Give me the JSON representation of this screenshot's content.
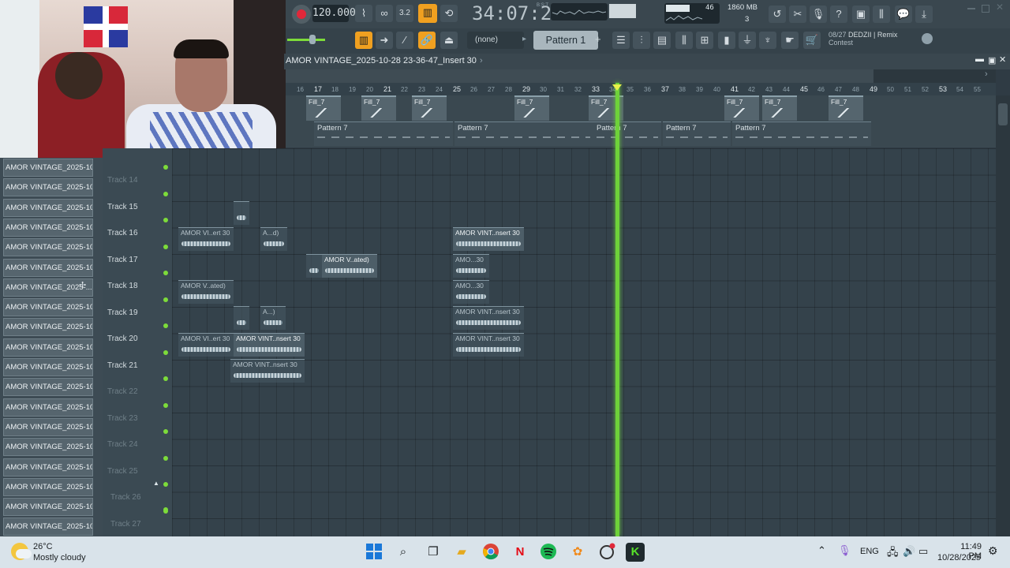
{
  "toolbar": {
    "tempo": "120.000",
    "time": "34:07:2",
    "time_sub": "B:S:T",
    "cpu": "46",
    "mem": "1860 MB",
    "voices": "3",
    "pattern_none": "(none)",
    "pattern_name": "Pattern 1",
    "hint_date": "08/27",
    "hint_line1": "DEDZII | Remix",
    "hint_line2": "Contest"
  },
  "playlist": {
    "title": "AMOR VINTAGE_2025-10-28 23-36-47_Insert 30",
    "ruler": [
      "16",
      "17",
      "18",
      "19",
      "20",
      "21",
      "22",
      "23",
      "24",
      "25",
      "26",
      "27",
      "28",
      "29",
      "30",
      "31",
      "32",
      "33",
      "34",
      "35",
      "36",
      "37",
      "38",
      "39",
      "40",
      "41",
      "42",
      "43",
      "44",
      "45",
      "46",
      "47",
      "48",
      "49",
      "50",
      "51",
      "52",
      "53",
      "54",
      "55"
    ],
    "fills": [
      "Fill_7",
      "Fill_7",
      "Fill_7",
      "Fill_7",
      "Fill_7",
      "Fill_7",
      "Fill_7",
      "Fill_7"
    ],
    "patterns": [
      "Pattern 7",
      "Pattern 7",
      "Pattern 7",
      "Pattern 7",
      "Pattern 7"
    ],
    "tracks": [
      "Track 14",
      "Track 15",
      "Track 16",
      "Track 17",
      "Track 18",
      "Track 19",
      "Track 20",
      "Track 21",
      "Track 22",
      "Track 23",
      "Track 24",
      "Track 25",
      "Track 26",
      "Track 27"
    ],
    "clips": {
      "c16a": "AMOR VI..ert 30",
      "c16b": "A...d)",
      "c16c": "AMOR VINT..nsert 30",
      "c17a": "AMOR V..ated)",
      "c17b": "AMO...30",
      "c18a": "AMOR V..ated)",
      "c18b": "AMO...30",
      "c19a": "A...)",
      "c19b": "AMOR VINT..nsert 30",
      "c20a": "AMOR VI..ert 30",
      "c20b": "AMOR VINT..nsert 30",
      "c20c": "AMOR VINT..nsert 30",
      "c21a": "AMOR VINT..nsert 30"
    }
  },
  "browser": {
    "items": [
      "AMOR VINTAGE_2025-10-...",
      "AMOR VINTAGE_2025-10-...",
      "AMOR VINTAGE_2025-10-...",
      "AMOR VINTAGE_2025-10-...",
      "AMOR VINTAGE_2025-10-...",
      "AMOR VINTAGE_2025-10-...",
      "AMOR VINTAGE_2025-...",
      "AMOR VINTAGE_2025-10-...",
      "AMOR VINTAGE_2025-10-...",
      "AMOR VINTAGE_2025-10-...",
      "AMOR VINTAGE_2025-10-...",
      "AMOR VINTAGE_2025-10-...",
      "AMOR VINTAGE_2025-10-...",
      "AMOR VINTAGE_2025-10-...",
      "AMOR VINTAGE_2025-10-...",
      "AMOR VINTAGE_2025-10-...",
      "AMOR VINTAGE_2025-10-...",
      "AMOR VINTAGE_2025-10-...",
      "AMOR VINTAGE_2025-10-..."
    ]
  },
  "taskbar": {
    "temperature": "26°C",
    "weather": "Mostly cloudy",
    "language": "ENG",
    "clock_time": "11:49 PM",
    "clock_date": "10/28/2025"
  },
  "colors": {
    "playhead": "#6ed23a",
    "accent": "#f0a020",
    "record": "#e0283a"
  }
}
